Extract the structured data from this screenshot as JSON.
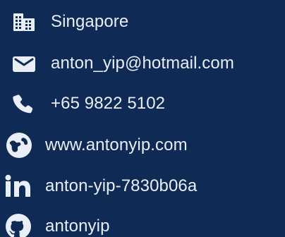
{
  "contact": {
    "items": [
      {
        "icon": "building-icon",
        "label": "Singapore"
      },
      {
        "icon": "mail-icon",
        "label": "anton_yip@hotmail.com"
      },
      {
        "icon": "phone-icon",
        "label": "+65 9822 5102"
      },
      {
        "icon": "globe-icon",
        "label": "www.antonyip.com"
      },
      {
        "icon": "linkedin-icon",
        "label": "anton-yip-7830b06a"
      },
      {
        "icon": "github-icon",
        "label": "antonyip"
      }
    ]
  },
  "colors": {
    "background": "#0f2a55",
    "foreground": "#e9eef7"
  }
}
